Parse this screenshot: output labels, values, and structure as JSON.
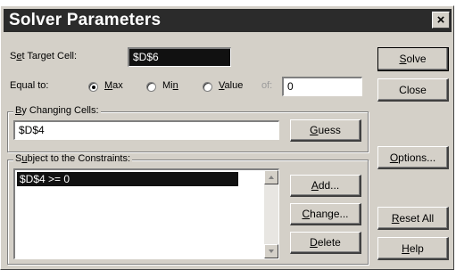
{
  "window": {
    "title": "Solver Parameters",
    "close_glyph": "×"
  },
  "target": {
    "label_pre": "S",
    "label_ul": "e",
    "label_post": "t Target Cell:",
    "value": "$D$6"
  },
  "equal_to": {
    "label": "Equal to:",
    "options": [
      {
        "pre": "",
        "ul": "M",
        "post": "ax",
        "checked": true
      },
      {
        "pre": "Mi",
        "ul": "n",
        "post": "",
        "checked": false
      },
      {
        "pre": "",
        "ul": "V",
        "post": "alue",
        "checked": false
      }
    ],
    "of_label": "of:",
    "value": "0"
  },
  "changing": {
    "label_pre": "",
    "label_ul": "B",
    "label_post": "y Changing Cells:",
    "value": "$D$4",
    "guess_ul": "G",
    "guess_post": "uess"
  },
  "constraints": {
    "label_pre": "S",
    "label_ul": "u",
    "label_post": "bject to the Constraints:",
    "items": [
      "$D$4 >= 0"
    ],
    "add": {
      "ul": "A",
      "post": "dd..."
    },
    "change": {
      "ul": "C",
      "post": "hange..."
    },
    "delete": {
      "ul": "D",
      "post": "elete"
    }
  },
  "side_buttons": {
    "solve": {
      "ul": "S",
      "post": "olve"
    },
    "close": {
      "label": "Close"
    },
    "options": {
      "ul": "O",
      "post": "ptions..."
    },
    "reset": {
      "ul": "R",
      "post": "eset All"
    },
    "help": {
      "ul": "H",
      "post": "elp"
    }
  }
}
